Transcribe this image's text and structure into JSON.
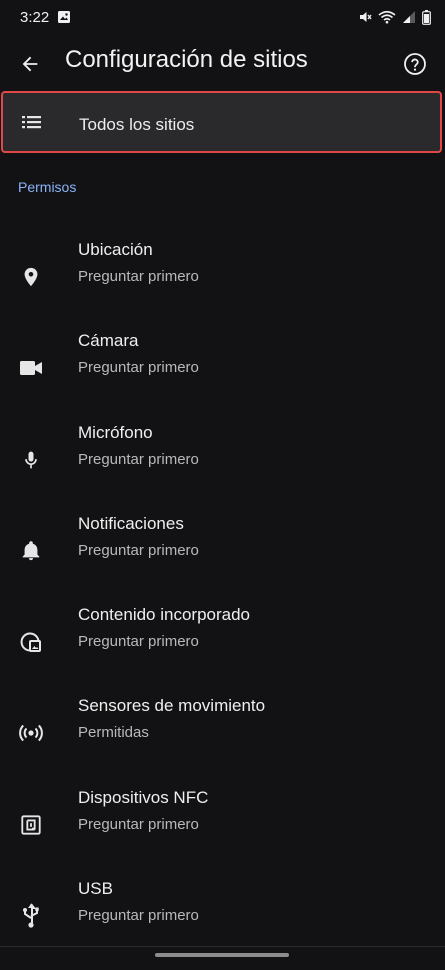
{
  "status_bar": {
    "time": "3:22",
    "icons": [
      "image-icon",
      "mute-icon",
      "wifi-icon",
      "signal-icon",
      "battery-icon"
    ]
  },
  "app_bar": {
    "title": "Configuración de sitios",
    "back_icon": "arrow-back-icon",
    "help_icon": "help-circle-icon"
  },
  "all_sites": {
    "label": "Todos los sitios",
    "icon": "list-icon",
    "highlight_color": "#e04848"
  },
  "section": {
    "title": "Permisos",
    "color": "#8ab4f8"
  },
  "permissions": [
    {
      "title": "Ubicación",
      "subtitle": "Preguntar primero",
      "icon": "location-pin-icon"
    },
    {
      "title": "Cámara",
      "subtitle": "Preguntar primero",
      "icon": "camera-icon"
    },
    {
      "title": "Micrófono",
      "subtitle": "Preguntar primero",
      "icon": "microphone-icon"
    },
    {
      "title": "Notificaciones",
      "subtitle": "Preguntar primero",
      "icon": "bell-icon"
    },
    {
      "title": "Contenido incorporado",
      "subtitle": "Preguntar primero",
      "icon": "embedded-content-icon"
    },
    {
      "title": "Sensores de movimiento",
      "subtitle": "Permitidas",
      "icon": "motion-sensor-icon"
    },
    {
      "title": "Dispositivos NFC",
      "subtitle": "Preguntar primero",
      "icon": "nfc-icon"
    },
    {
      "title": "USB",
      "subtitle": "Preguntar primero",
      "icon": "usb-icon"
    }
  ]
}
